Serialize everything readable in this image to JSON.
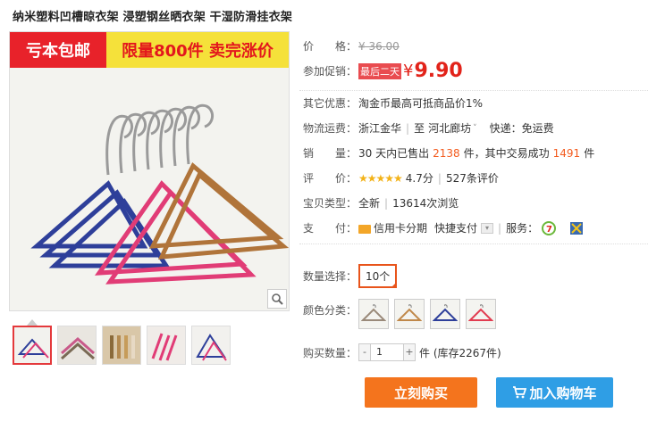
{
  "product": {
    "title": "纳米塑料凹槽晾衣架 浸塑钢丝晒衣架 干湿防滑挂衣架"
  },
  "image": {
    "banner_left": "亏本包邮",
    "banner_right": "限量800件 卖完涨价"
  },
  "price": {
    "label": "价　　格：",
    "original": "¥ 36.00",
    "promo_label": "参加促销：",
    "promo_tag": "最后二天",
    "currency": "¥",
    "current": "9.90"
  },
  "other": {
    "label": "其它优惠：",
    "value": "淘金币最高可抵商品价1%"
  },
  "shipping": {
    "label": "物流运费：",
    "from": "浙江金华",
    "to_word": "至",
    "to": "河北廊坊",
    "express": "快递：免运费"
  },
  "sales": {
    "label": "销　　量：",
    "prefix": "30 天内已售出",
    "sold": "2138",
    "mid": "件，其中交易成功",
    "success": "1491",
    "suffix": "件"
  },
  "rating": {
    "label": "评　　价：",
    "stars": "★★★★★",
    "score": "4.7分",
    "reviews": "527条评价"
  },
  "condition": {
    "label": "宝贝类型：",
    "value": "全新",
    "views": "13614次浏览"
  },
  "payment": {
    "label": "支　　付：",
    "card": "信用卡分期",
    "fast": "快捷支付",
    "service_label": "服务："
  },
  "quantity_option": {
    "label": "数量选择：",
    "selected": "10个"
  },
  "color": {
    "label": "颜色分类：",
    "swatches": [
      "silver-hanger",
      "gold-hanger",
      "blue-hanger",
      "red-hanger"
    ]
  },
  "purchase": {
    "label": "购买数量：",
    "minus": "-",
    "value": "1",
    "plus": "+",
    "stock": "件 (库存2267件)"
  },
  "actions": {
    "buy": "立刻购买",
    "cart": "加入购物车"
  },
  "colors": {
    "accent_red": "#e2231a",
    "orange": "#f4741d",
    "blue": "#2f9ee5"
  }
}
